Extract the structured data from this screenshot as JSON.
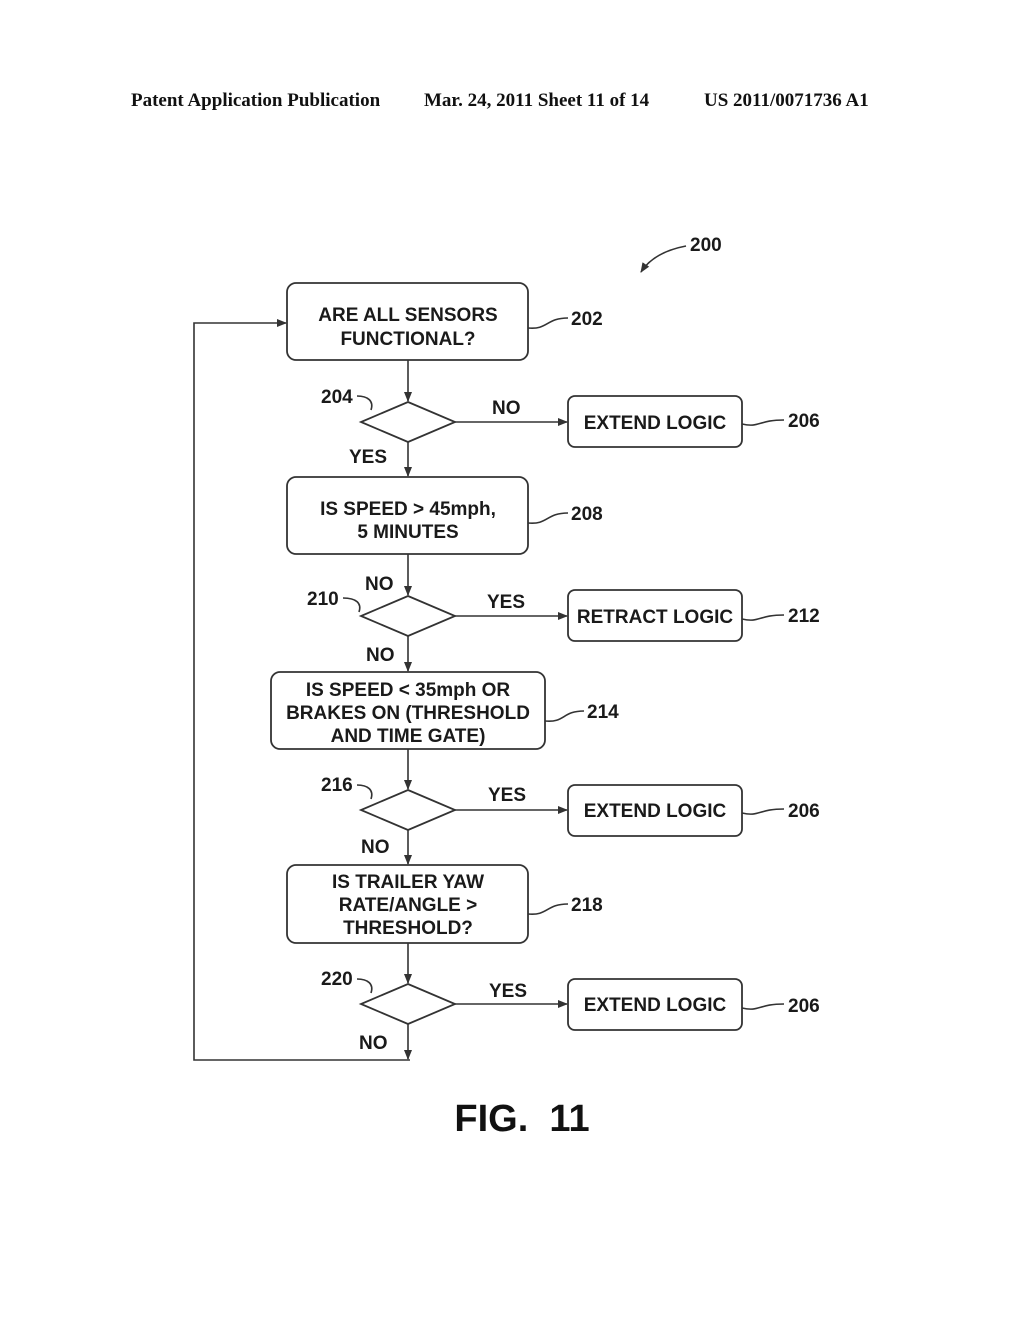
{
  "header": {
    "left": "Patent Application Publication",
    "center": "Mar. 24, 2011  Sheet 11 of 14",
    "right": "US 2011/0071736 A1"
  },
  "diagram": {
    "ref_overall": "200",
    "steps": [
      {
        "id": "202",
        "type": "process",
        "lines": [
          "ARE ALL SENSORS",
          "FUNCTIONAL?"
        ]
      },
      {
        "id": "204",
        "type": "decision",
        "out_side": "NO",
        "out_down": "YES",
        "side_target": "206"
      },
      {
        "id": "208",
        "type": "process",
        "lines": [
          "IS SPEED > 45mph,",
          "5 MINUTES"
        ]
      },
      {
        "id": "210",
        "type": "decision",
        "in_label": "NO",
        "out_side": "YES",
        "out_down": "NO",
        "side_target": "212"
      },
      {
        "id": "214",
        "type": "process",
        "lines": [
          "IS SPEED < 35mph OR",
          "BRAKES ON (THRESHOLD",
          "AND TIME GATE)"
        ]
      },
      {
        "id": "216",
        "type": "decision",
        "out_side": "YES",
        "out_down": "NO",
        "side_target": "206"
      },
      {
        "id": "218",
        "type": "process",
        "lines": [
          "IS TRAILER YAW",
          "RATE/ANGLE >",
          "THRESHOLD?"
        ]
      },
      {
        "id": "220",
        "type": "decision",
        "out_side": "YES",
        "out_down": "NO",
        "side_target": "206"
      }
    ],
    "side_boxes": [
      {
        "id": "206",
        "label": "EXTEND LOGIC"
      },
      {
        "id": "212",
        "label": "RETRACT LOGIC"
      },
      {
        "id": "206",
        "label": "EXTEND LOGIC"
      },
      {
        "id": "206",
        "label": "EXTEND LOGIC"
      }
    ],
    "loop_back_to": "202"
  },
  "figure_label": "FIG.  11"
}
